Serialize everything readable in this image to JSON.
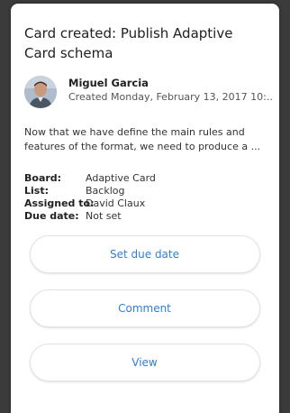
{
  "card": {
    "title": "Card created: Publish Adaptive Card schema",
    "author": {
      "name": "Miguel Garcia",
      "created": "Created Monday, February 13, 2017 10:..."
    },
    "body_lines": [
      "Now that we have define the main rules and",
      "features of the format, we need to produce a ..."
    ],
    "facts": [
      {
        "label": "Board:",
        "value": "Adaptive Card"
      },
      {
        "label": "List:",
        "value": "Backlog"
      },
      {
        "label": "Assigned to:",
        "value": "David Claux"
      },
      {
        "label": "Due date:",
        "value": "Not set"
      }
    ],
    "actions": [
      {
        "label": "Set due date"
      },
      {
        "label": "Comment"
      },
      {
        "label": "View"
      }
    ]
  },
  "colors": {
    "background": "#3b3b3b",
    "card": "#ffffff",
    "action_text": "#2f7fd6"
  },
  "icons": {
    "avatar": "user-avatar-photo"
  }
}
